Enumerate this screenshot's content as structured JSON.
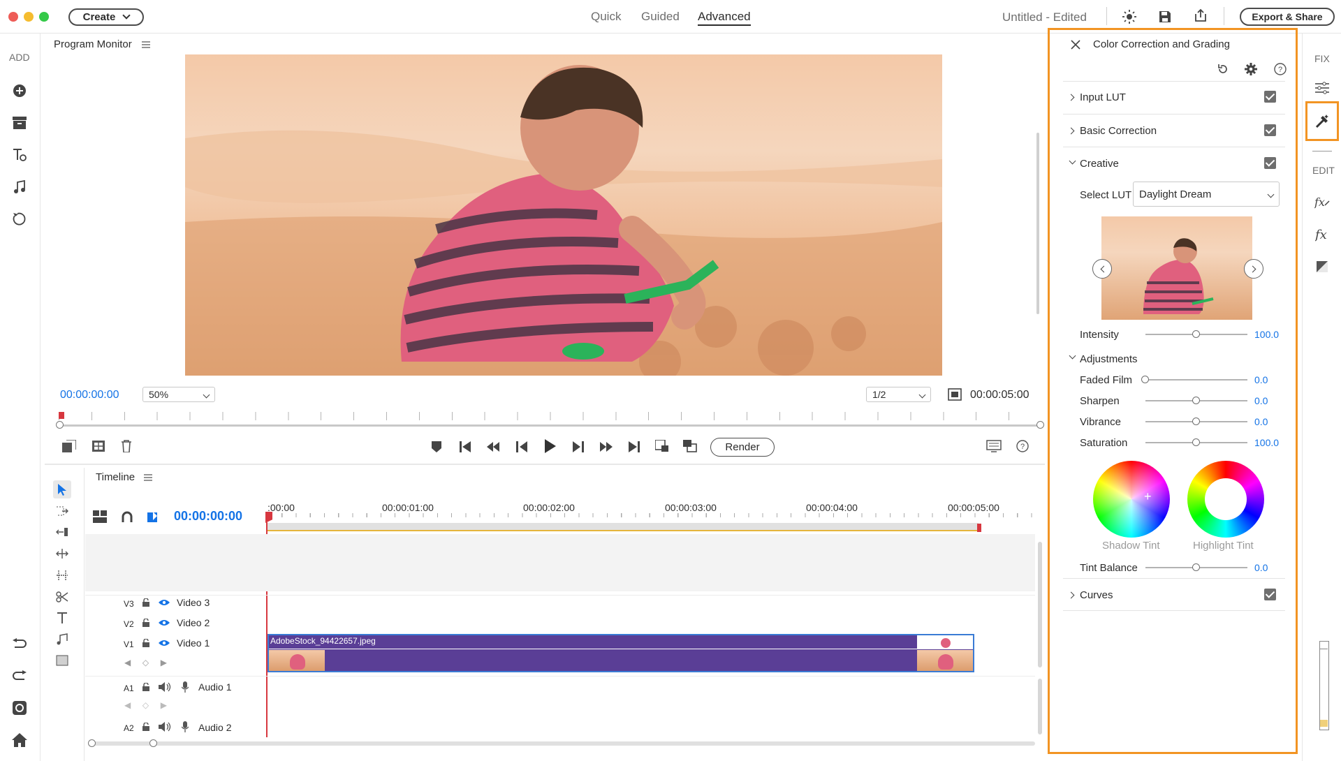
{
  "window": {
    "create_label": "Create",
    "tabs": [
      {
        "label": "Quick"
      },
      {
        "label": "Guided"
      },
      {
        "label": "Advanced"
      }
    ],
    "doc_title": "Untitled - Edited",
    "export_label": "Export & Share"
  },
  "left_rail": {
    "add_label": "ADD",
    "icons": [
      "add-media-icon",
      "archive-icon",
      "titles-icon",
      "music-icon",
      "graphics-icon"
    ],
    "bottom_icons": [
      "undo-icon",
      "redo-icon",
      "organizer-icon",
      "home-icon"
    ]
  },
  "right_rail": {
    "fix_label": "FIX",
    "edit_label": "EDIT"
  },
  "monitor": {
    "title": "Program Monitor",
    "current_time": "00:00:00:00",
    "zoom": "50%",
    "resolution": "1/2",
    "duration": "00:00:05:00",
    "render_label": "Render"
  },
  "timeline": {
    "title": "Timeline",
    "current_time": "00:00:00:00",
    "ruler": [
      ":00:00",
      "00:00:01:00",
      "00:00:02:00",
      "00:00:03:00",
      "00:00:04:00",
      "00:00:05:00"
    ],
    "video_tracks": [
      {
        "id": "V3",
        "name": "Video 3"
      },
      {
        "id": "V2",
        "name": "Video 2"
      },
      {
        "id": "V1",
        "name": "Video 1"
      }
    ],
    "audio_tracks": [
      {
        "id": "A1",
        "name": "Audio 1"
      },
      {
        "id": "A2",
        "name": "Audio 2"
      }
    ],
    "clip_name": "AdobeStock_94422657.jpeg"
  },
  "panel": {
    "title": "Color Correction and Grading",
    "sections": {
      "input_lut": "Input LUT",
      "basic_correction": "Basic Correction",
      "creative": "Creative",
      "adjustments": "Adjustments",
      "curves": "Curves"
    },
    "select_lut_label": "Select LUT",
    "lut_value": "Daylight Dream",
    "intensity": {
      "label": "Intensity",
      "value": "100.0",
      "level": 0.5
    },
    "adjustments": [
      {
        "label": "Faded Film",
        "value": "0.0",
        "level": 0.0
      },
      {
        "label": "Sharpen",
        "value": "0.0",
        "level": 0.5
      },
      {
        "label": "Vibrance",
        "value": "0.0",
        "level": 0.5
      },
      {
        "label": "Saturation",
        "value": "100.0",
        "level": 0.5
      }
    ],
    "shadow_tint_label": "Shadow Tint",
    "highlight_tint_label": "Highlight Tint",
    "tint_balance": {
      "label": "Tint Balance",
      "value": "0.0",
      "level": 0.5
    }
  },
  "colors": {
    "accent": "#1473e6",
    "highlight_border": "#f29423",
    "clip": "#5a3e96",
    "playhead": "#d7373f"
  }
}
